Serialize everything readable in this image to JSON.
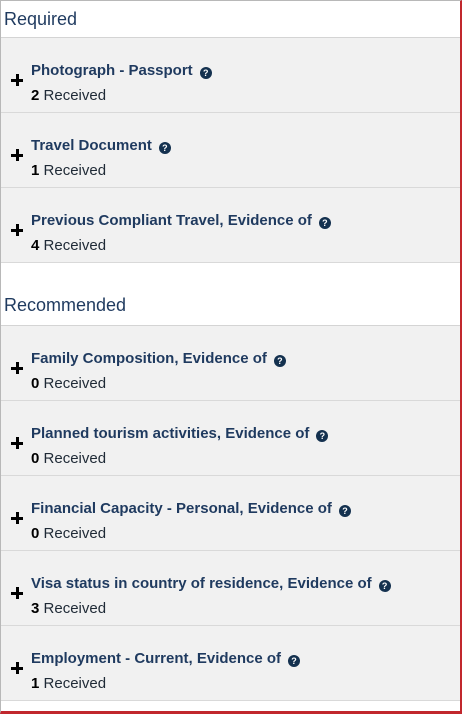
{
  "sections": [
    {
      "heading": "Required",
      "items": [
        {
          "title": "Photograph - Passport",
          "count": "2",
          "count_label": "Received"
        },
        {
          "title": "Travel Document",
          "count": "1",
          "count_label": "Received"
        },
        {
          "title": "Previous Compliant Travel, Evidence of",
          "count": "4",
          "count_label": "Received"
        }
      ]
    },
    {
      "heading": "Recommended",
      "items": [
        {
          "title": "Family Composition, Evidence of",
          "count": "0",
          "count_label": "Received"
        },
        {
          "title": "Planned tourism activities, Evidence of",
          "count": "0",
          "count_label": "Received"
        },
        {
          "title": "Financial Capacity - Personal, Evidence of",
          "count": "0",
          "count_label": "Received"
        },
        {
          "title": "Visa status in country of residence, Evidence of",
          "count": "3",
          "count_label": "Received"
        },
        {
          "title": "Employment - Current, Evidence of",
          "count": "1",
          "count_label": "Received"
        }
      ]
    }
  ],
  "icons": {
    "expand": "plus-icon",
    "help": "help-icon"
  },
  "help_glyph": "?",
  "colors": {
    "title": "#1f3a5f",
    "help_badge": "#14314f",
    "row_bg": "#f1f1f1",
    "frame_accent": "#c1272d"
  }
}
